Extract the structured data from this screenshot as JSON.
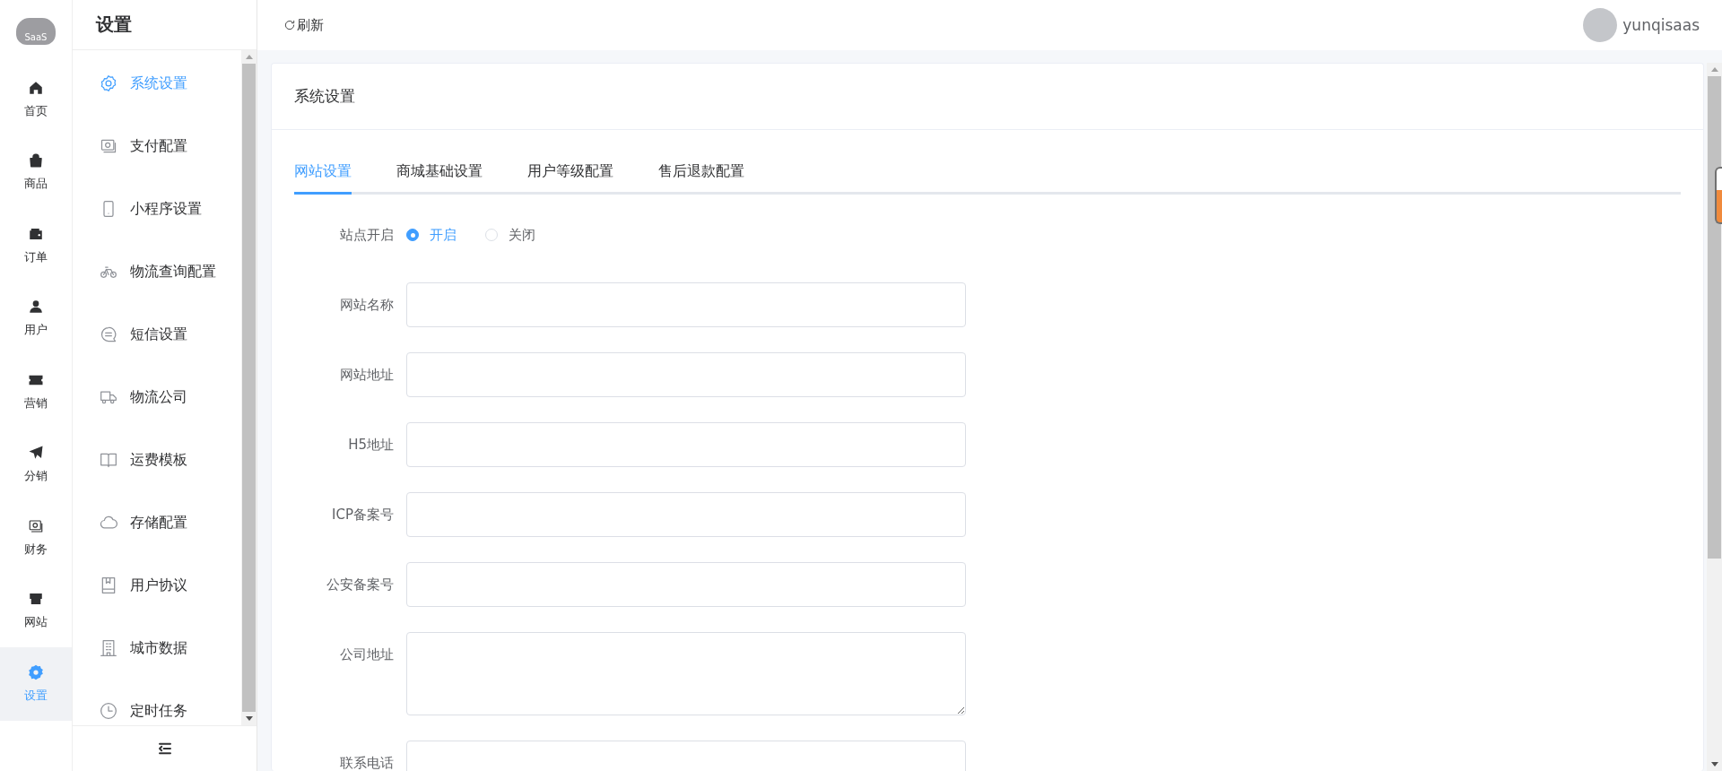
{
  "rail": {
    "logo": "SaaS",
    "items": [
      {
        "label": "首页",
        "selected": false
      },
      {
        "label": "商品",
        "selected": false
      },
      {
        "label": "订单",
        "selected": false
      },
      {
        "label": "用户",
        "selected": false
      },
      {
        "label": "营销",
        "selected": false
      },
      {
        "label": "分销",
        "selected": false
      },
      {
        "label": "财务",
        "selected": false
      },
      {
        "label": "网站",
        "selected": false
      },
      {
        "label": "设置",
        "selected": true
      }
    ]
  },
  "submenu": {
    "title": "设置",
    "items": [
      {
        "label": "系统设置",
        "selected": true
      },
      {
        "label": "支付配置",
        "selected": false
      },
      {
        "label": "小程序设置",
        "selected": false
      },
      {
        "label": "物流查询配置",
        "selected": false
      },
      {
        "label": "短信设置",
        "selected": false
      },
      {
        "label": "物流公司",
        "selected": false
      },
      {
        "label": "运费模板",
        "selected": false
      },
      {
        "label": "存储配置",
        "selected": false
      },
      {
        "label": "用户协议",
        "selected": false
      },
      {
        "label": "城市数据",
        "selected": false
      },
      {
        "label": "定时任务",
        "selected": false
      }
    ]
  },
  "topbar": {
    "refresh": "刷新",
    "user": "yunqisaas"
  },
  "card": {
    "title": "系统设置",
    "tabs": [
      {
        "label": "网站设置",
        "selected": true
      },
      {
        "label": "商城基础设置",
        "selected": false
      },
      {
        "label": "用户等级配置",
        "selected": false
      },
      {
        "label": "售后退款配置",
        "selected": false
      }
    ],
    "form": [
      {
        "kind": "radio",
        "label": "站点开启",
        "options": [
          {
            "label": "开启",
            "selected": true
          },
          {
            "label": "关闭",
            "selected": false
          }
        ]
      },
      {
        "kind": "input",
        "label": "网站名称"
      },
      {
        "kind": "input",
        "label": "网站地址"
      },
      {
        "kind": "input",
        "label": "H5地址"
      },
      {
        "kind": "input",
        "label": "ICP备案号"
      },
      {
        "kind": "input",
        "label": "公安备案号"
      },
      {
        "kind": "textarea",
        "label": "公司地址"
      },
      {
        "kind": "input",
        "label": "联系电话"
      }
    ]
  }
}
